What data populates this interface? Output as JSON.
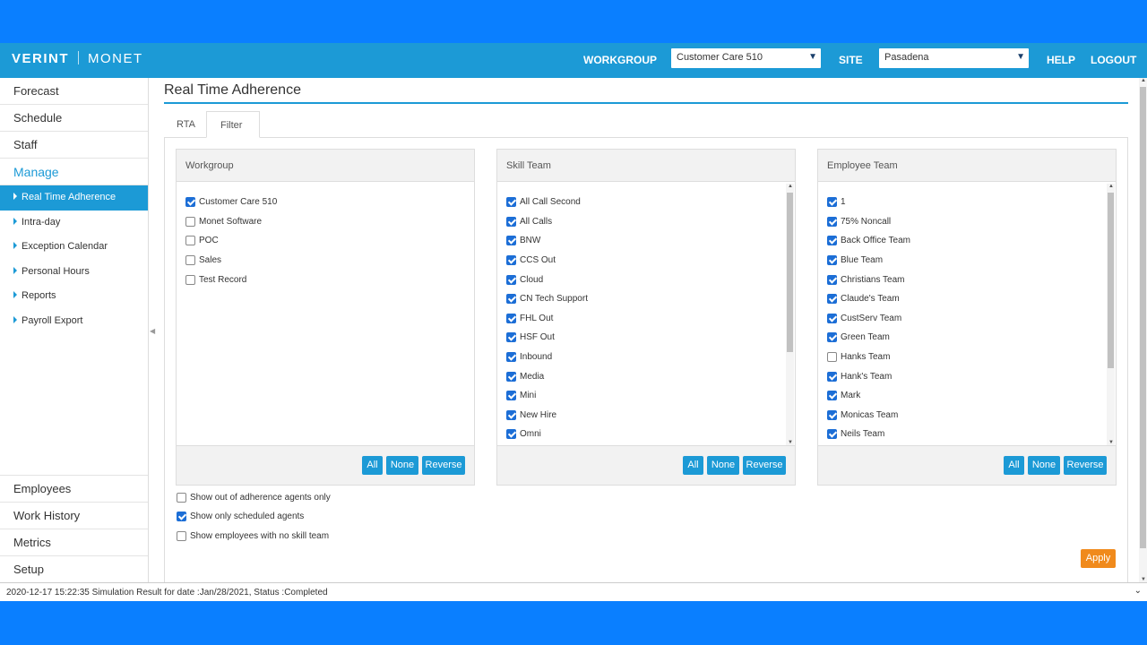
{
  "header": {
    "logo_left": "VERINT",
    "logo_right": "MONET",
    "workgroup_label": "WORKGROUP",
    "workgroup_value": "Customer Care 510",
    "site_label": "SITE",
    "site_value": "Pasadena",
    "help": "HELP",
    "logout": "LOGOUT"
  },
  "sidebar": {
    "top_items": [
      "Forecast",
      "Schedule",
      "Staff",
      "Manage"
    ],
    "sub_items": [
      "Real Time Adherence",
      "Intra-day",
      "Exception Calendar",
      "Personal Hours",
      "Reports",
      "Payroll Export"
    ],
    "bottom_items": [
      "Employees",
      "Work History",
      "Metrics",
      "Setup"
    ]
  },
  "main": {
    "title": "Real Time Adherence",
    "tabs": [
      "RTA",
      "Filter"
    ]
  },
  "panels": [
    {
      "title": "Workgroup",
      "items": [
        {
          "label": "Customer Care 510",
          "checked": true
        },
        {
          "label": "Monet Software",
          "checked": false
        },
        {
          "label": "POC",
          "checked": false
        },
        {
          "label": "Sales",
          "checked": false
        },
        {
          "label": "Test Record",
          "checked": false
        }
      ]
    },
    {
      "title": "Skill Team",
      "items": [
        {
          "label": "All Call Second",
          "checked": true
        },
        {
          "label": "All Calls",
          "checked": true
        },
        {
          "label": "BNW",
          "checked": true
        },
        {
          "label": "CCS Out",
          "checked": true
        },
        {
          "label": "Cloud",
          "checked": true
        },
        {
          "label": "CN Tech Support",
          "checked": true
        },
        {
          "label": "FHL Out",
          "checked": true
        },
        {
          "label": "HSF Out",
          "checked": true
        },
        {
          "label": "Inbound",
          "checked": true
        },
        {
          "label": "Media",
          "checked": true
        },
        {
          "label": "Mini",
          "checked": true
        },
        {
          "label": "New Hire",
          "checked": true
        },
        {
          "label": "Omni",
          "checked": true
        }
      ]
    },
    {
      "title": "Employee Team",
      "items": [
        {
          "label": "1",
          "checked": true
        },
        {
          "label": "75% Noncall",
          "checked": true
        },
        {
          "label": "Back Office Team",
          "checked": true
        },
        {
          "label": "Blue Team",
          "checked": true
        },
        {
          "label": "Christians Team",
          "checked": true
        },
        {
          "label": "Claude's Team",
          "checked": true
        },
        {
          "label": "CustServ Team",
          "checked": true
        },
        {
          "label": "Green Team",
          "checked": true
        },
        {
          "label": "Hanks Team",
          "checked": false
        },
        {
          "label": "Hank's Team",
          "checked": true
        },
        {
          "label": "Mark",
          "checked": true
        },
        {
          "label": "Monicas Team",
          "checked": true
        },
        {
          "label": "Neils Team",
          "checked": true
        }
      ]
    }
  ],
  "buttons": {
    "all": "All",
    "none": "None",
    "reverse": "Reverse",
    "apply": "Apply"
  },
  "options": [
    {
      "label": "Show out of adherence agents only",
      "checked": false
    },
    {
      "label": "Show only scheduled agents",
      "checked": true
    },
    {
      "label": "Show employees with no skill team",
      "checked": false
    }
  ],
  "status": "2020-12-17 15:22:35 Simulation Result for date :Jan/28/2021, Status :Completed",
  "colors": {
    "brand": "#1c9ad6",
    "outer": "#0a7fff",
    "apply": "#f08a1c",
    "checkbox": "#1c6ed6"
  }
}
